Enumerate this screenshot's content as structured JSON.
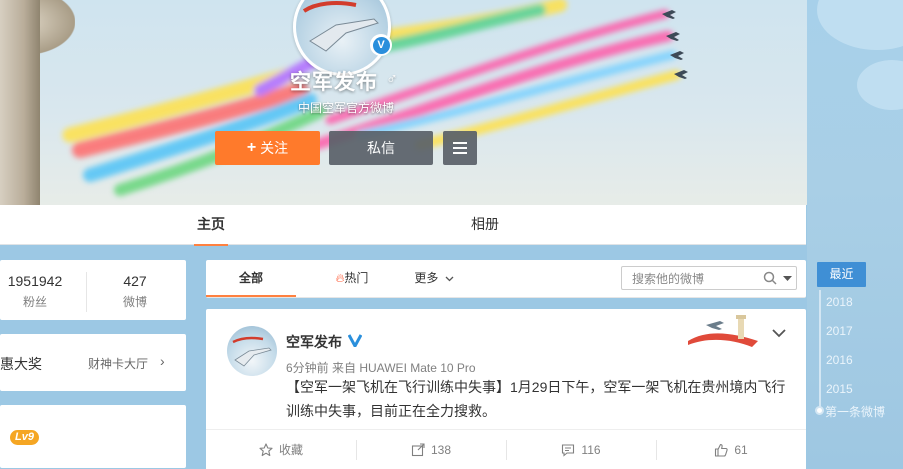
{
  "profile": {
    "name": "空军发布",
    "description": "中国空军官方微博",
    "follow_label": "关注",
    "message_label": "私信"
  },
  "nav": {
    "tabs": [
      "主页",
      "相册"
    ]
  },
  "stats": {
    "followers_count": "1951942",
    "followers_label": "粉丝",
    "posts_count": "427",
    "posts_label": "微博"
  },
  "side_cards": {
    "lottery_label": "惠大奖",
    "lottery_link": "财神卡大厅",
    "level_badge": "Lv9"
  },
  "feed": {
    "tabs": {
      "all": "全部",
      "hot": "热门",
      "more": "更多"
    },
    "search_placeholder": "搜索他的微博"
  },
  "post": {
    "author": "空军发布",
    "meta": "6分钟前 来自 HUAWEI Mate 10 Pro",
    "text": "【空军一架飞机在飞行训练中失事】1月29日下午，空军一架飞机在贵州境内飞行训练中失事，目前正在全力搜救。",
    "actions": {
      "favorite": "收藏",
      "repost": "138",
      "comment": "116",
      "like": "61"
    }
  },
  "timeline": {
    "current": "最近",
    "years": [
      "2018",
      "2017",
      "2016",
      "2015"
    ],
    "first": "第一条微博"
  },
  "colors": {
    "follow_button": "#ff7a2b",
    "verified_blue": "#2a8fdc",
    "tab_underline": "#ff8140",
    "level_badge": "#f5a623"
  }
}
